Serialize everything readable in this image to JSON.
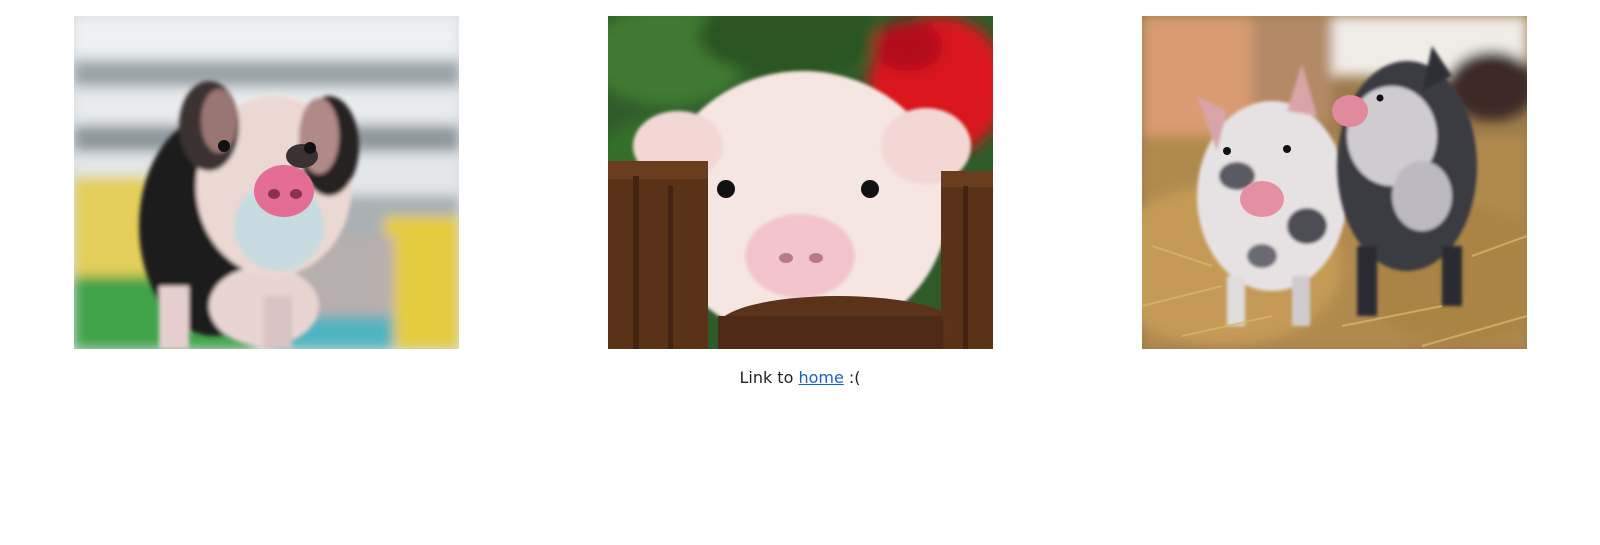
{
  "gallery": {
    "images": [
      {
        "name": "piglet-black-white-photo"
      },
      {
        "name": "piglet-pink-fence-photo"
      },
      {
        "name": "two-spotted-piglets-photo"
      }
    ]
  },
  "footer": {
    "prefix": "Link to ",
    "link_label": "home",
    "suffix": " :("
  },
  "colors": {
    "link": "#1a5fd1",
    "text": "#222222"
  }
}
